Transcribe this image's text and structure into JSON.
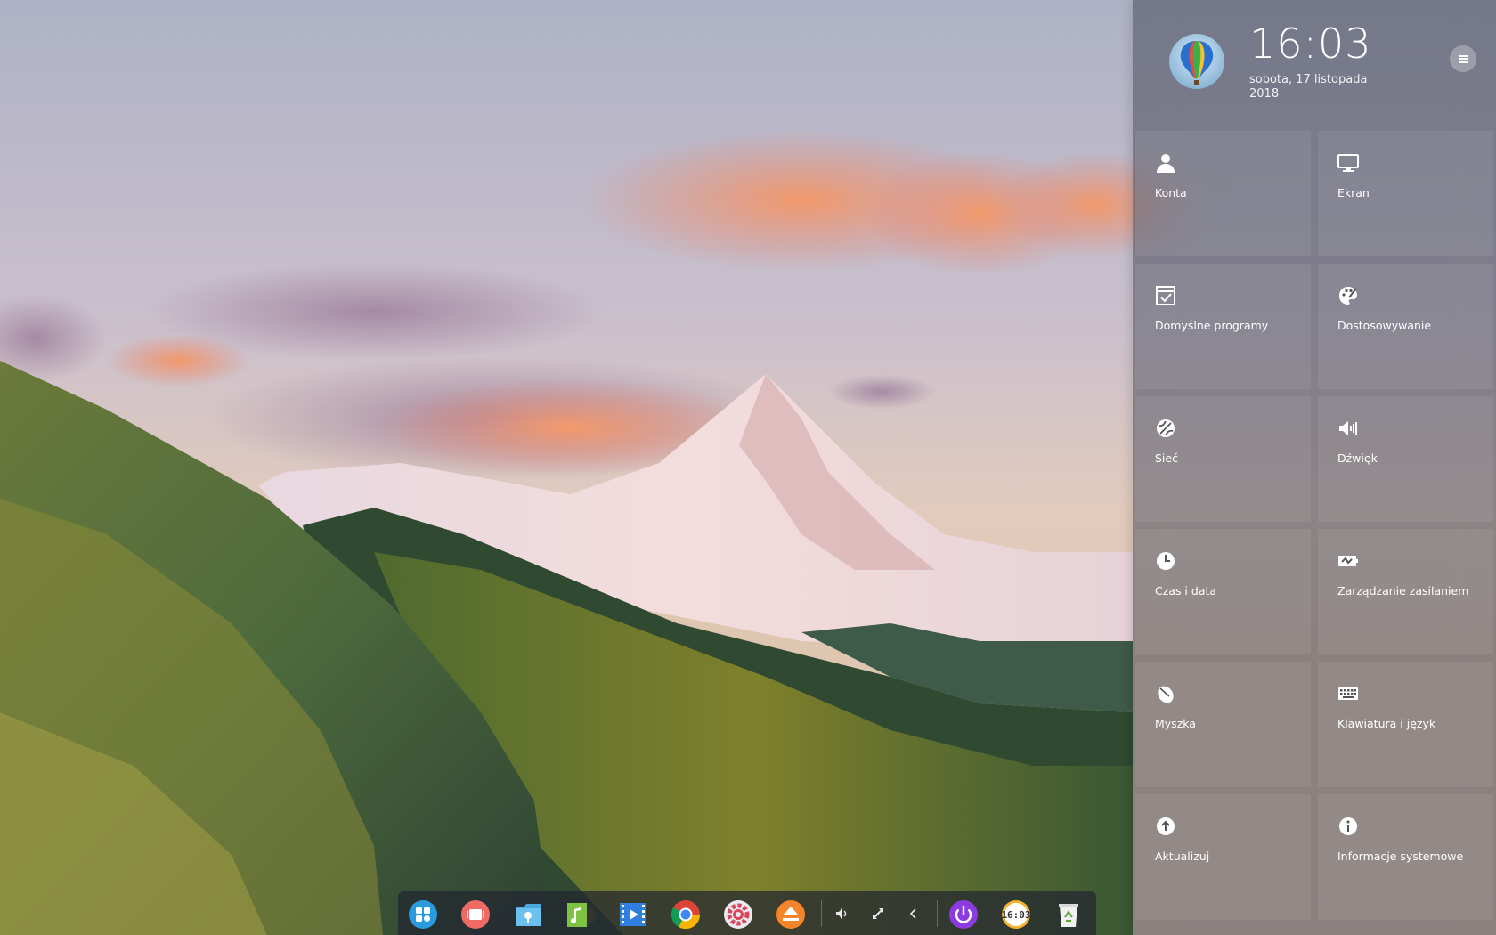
{
  "control_center": {
    "time": "16:03",
    "date_line1": "sobota, 17 listopada",
    "date_line2": "2018",
    "tiles": [
      {
        "label": "Konta",
        "icon": "user-icon"
      },
      {
        "label": "Ekran",
        "icon": "monitor-icon"
      },
      {
        "label": "Domyślne programy",
        "icon": "default-apps-icon"
      },
      {
        "label": "Dostosowywanie",
        "icon": "palette-icon"
      },
      {
        "label": "Sieć",
        "icon": "network-globe-icon"
      },
      {
        "label": "Dźwięk",
        "icon": "speaker-icon"
      },
      {
        "label": "Czas i data",
        "icon": "clock-icon"
      },
      {
        "label": "Zarządzanie zasilaniem",
        "icon": "battery-icon"
      },
      {
        "label": "Myszka",
        "icon": "mouse-icon"
      },
      {
        "label": "Klawiatura i język",
        "icon": "keyboard-icon"
      },
      {
        "label": "Aktualizuj",
        "icon": "update-icon"
      },
      {
        "label": "Informacje systemowe",
        "icon": "info-icon"
      }
    ]
  },
  "dock": {
    "apps": [
      {
        "name": "launcher",
        "icon": "launcher-icon"
      },
      {
        "name": "multitasking",
        "icon": "multitasking-icon"
      },
      {
        "name": "file-manager",
        "icon": "folder-icon"
      },
      {
        "name": "music",
        "icon": "music-icon"
      },
      {
        "name": "movie",
        "icon": "movie-icon"
      },
      {
        "name": "chrome",
        "icon": "chrome-icon"
      },
      {
        "name": "settings",
        "icon": "settings-gear-icon"
      },
      {
        "name": "installer",
        "icon": "eject-icon"
      }
    ],
    "tray": [
      {
        "name": "volume",
        "icon": "volume-icon"
      },
      {
        "name": "network",
        "icon": "network-icon"
      },
      {
        "name": "collapse",
        "icon": "chevron-left-icon"
      }
    ],
    "right": [
      {
        "name": "power",
        "icon": "power-icon"
      },
      {
        "name": "clock",
        "icon": "dock-clock-icon",
        "text": "16:03"
      },
      {
        "name": "trash",
        "icon": "trash-icon"
      }
    ]
  },
  "colors": {
    "accent": "#2b8cd9",
    "panel_bg": "#464858",
    "dock_bg": "#232630"
  }
}
